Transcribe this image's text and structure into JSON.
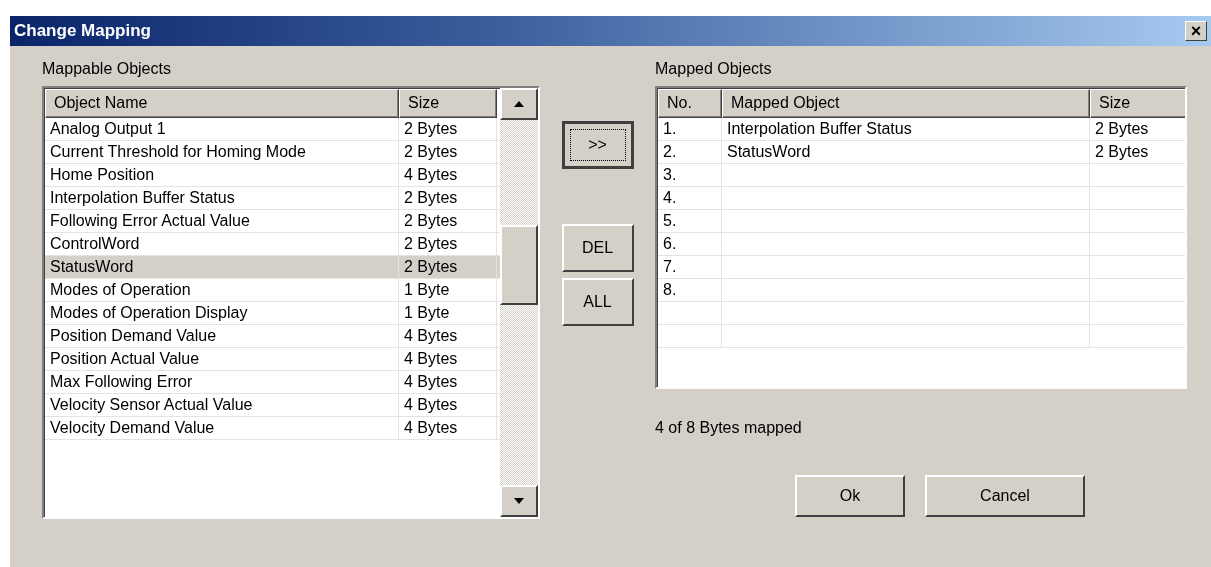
{
  "window": {
    "title": "Change Mapping",
    "close": "×"
  },
  "mappable": {
    "label": "Mappable Objects",
    "columns": [
      "Object Name",
      "Size"
    ],
    "rows": [
      {
        "name": "Analog Output 1",
        "size": "2 Bytes",
        "selected": false
      },
      {
        "name": "Current Threshold for Homing Mode",
        "size": "2 Bytes",
        "selected": false
      },
      {
        "name": "Home Position",
        "size": "4 Bytes",
        "selected": false
      },
      {
        "name": "Interpolation Buffer Status",
        "size": "2 Bytes",
        "selected": false
      },
      {
        "name": "Following Error Actual Value",
        "size": "2 Bytes",
        "selected": false
      },
      {
        "name": "ControlWord",
        "size": "2 Bytes",
        "selected": false
      },
      {
        "name": "StatusWord",
        "size": "2 Bytes",
        "selected": true
      },
      {
        "name": "Modes of Operation",
        "size": "1 Byte",
        "selected": false
      },
      {
        "name": "Modes of Operation Display",
        "size": "1 Byte",
        "selected": false
      },
      {
        "name": "Position Demand Value",
        "size": "4 Bytes",
        "selected": false
      },
      {
        "name": "Position Actual Value",
        "size": "4 Bytes",
        "selected": false
      },
      {
        "name": "Max Following Error",
        "size": "4 Bytes",
        "selected": false
      },
      {
        "name": "Velocity Sensor Actual Value",
        "size": "4 Bytes",
        "selected": false
      },
      {
        "name": "Velocity Demand Value",
        "size": "4 Bytes",
        "selected": false
      }
    ]
  },
  "transfer_buttons": [
    {
      "label": ">>",
      "focused": true
    },
    {
      "label": "DEL",
      "focused": false
    },
    {
      "label": "ALL",
      "focused": false
    }
  ],
  "mapped": {
    "label": "Mapped Objects",
    "columns": [
      "No.",
      "Mapped Object",
      "Size"
    ],
    "rows": [
      {
        "no": "1.",
        "name": "Interpolation Buffer Status",
        "size": "2 Bytes"
      },
      {
        "no": "2.",
        "name": "StatusWord",
        "size": "2 Bytes"
      },
      {
        "no": "3."
      },
      {
        "no": "4."
      },
      {
        "no": "5."
      },
      {
        "no": "6."
      },
      {
        "no": "7."
      },
      {
        "no": "8."
      },
      {},
      {}
    ]
  },
  "status": "4 of 8 Bytes mapped",
  "buttons": [
    "Ok",
    "Cancel"
  ]
}
